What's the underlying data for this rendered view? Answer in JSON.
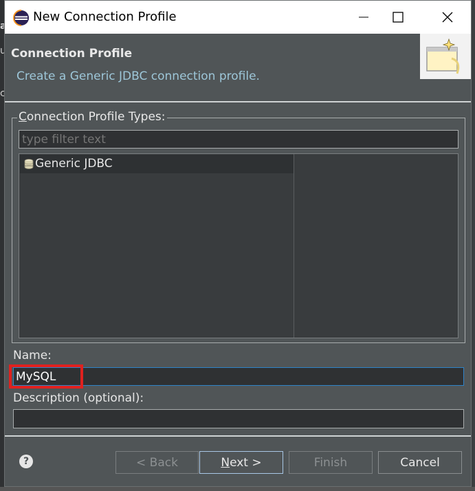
{
  "window": {
    "title": "New Connection Profile"
  },
  "backdrop": {
    "fragments": [
      "a",
      "ul",
      "c"
    ]
  },
  "banner": {
    "heading": "Connection Profile",
    "description": "Create a Generic JDBC connection profile."
  },
  "profile_types": {
    "group_label": "Connection Profile Types:",
    "group_label_mnemonic": "C",
    "group_label_rest": "onnection Profile Types:",
    "filter_placeholder": "type filter text",
    "items": [
      {
        "label": "Generic JDBC",
        "icon": "database-icon",
        "selected": true
      }
    ]
  },
  "form": {
    "name_label": "Name:",
    "name_value": "MySQL",
    "description_label": "Description (optional):",
    "description_value": ""
  },
  "buttons": {
    "back": "< Back",
    "next_mnemonic": "N",
    "next_rest": "ext >",
    "finish": "Finish",
    "cancel": "Cancel",
    "help": "?"
  },
  "colors": {
    "dialog_bg": "#505557",
    "accent": "#2e83c8",
    "highlight": "#e0211f",
    "description_text": "#9dc6d8"
  }
}
